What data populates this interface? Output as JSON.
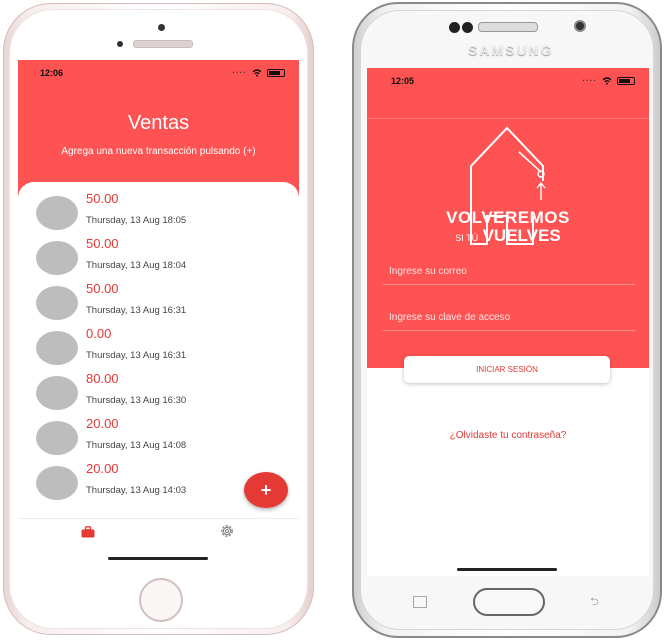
{
  "left_phone": {
    "status_time": "12:06",
    "title": "Ventas",
    "subtitle": "Agrega una nueva transacción pulsando (+)",
    "sales": [
      {
        "amount": "50.00",
        "date": "Thursday, 13 Aug 18:05"
      },
      {
        "amount": "50.00",
        "date": "Thursday, 13 Aug 18:04"
      },
      {
        "amount": "50.00",
        "date": "Thursday, 13 Aug 16:31"
      },
      {
        "amount": "0.00",
        "date": "Thursday, 13 Aug 16:31"
      },
      {
        "amount": "80.00",
        "date": "Thursday, 13 Aug 16:30"
      },
      {
        "amount": "20.00",
        "date": "Thursday, 13 Aug 14:08"
      },
      {
        "amount": "20.00",
        "date": "Thursday, 13 Aug 14:03"
      }
    ],
    "fab_label": "+",
    "tabs": [
      {
        "icon": "briefcase-icon",
        "active": true
      },
      {
        "icon": "gear-icon",
        "active": false
      }
    ]
  },
  "right_phone": {
    "brand": "SAMSUNG",
    "status_time": "12:05",
    "logo_line1": "VOLVEREMOS",
    "logo_line2_small": "SI TÚ",
    "logo_line2_big": "VUELVES",
    "email_placeholder": "Ingrese su correo",
    "password_placeholder": "Ingrese su clave de acceso",
    "login_label": "INICIAR SESIÓN",
    "forgot_label": "¿Olvidaste tu contraseña?"
  },
  "colors": {
    "primary": "#ff5252",
    "accent": "#e53935",
    "avatar": "#bdbdbd"
  }
}
